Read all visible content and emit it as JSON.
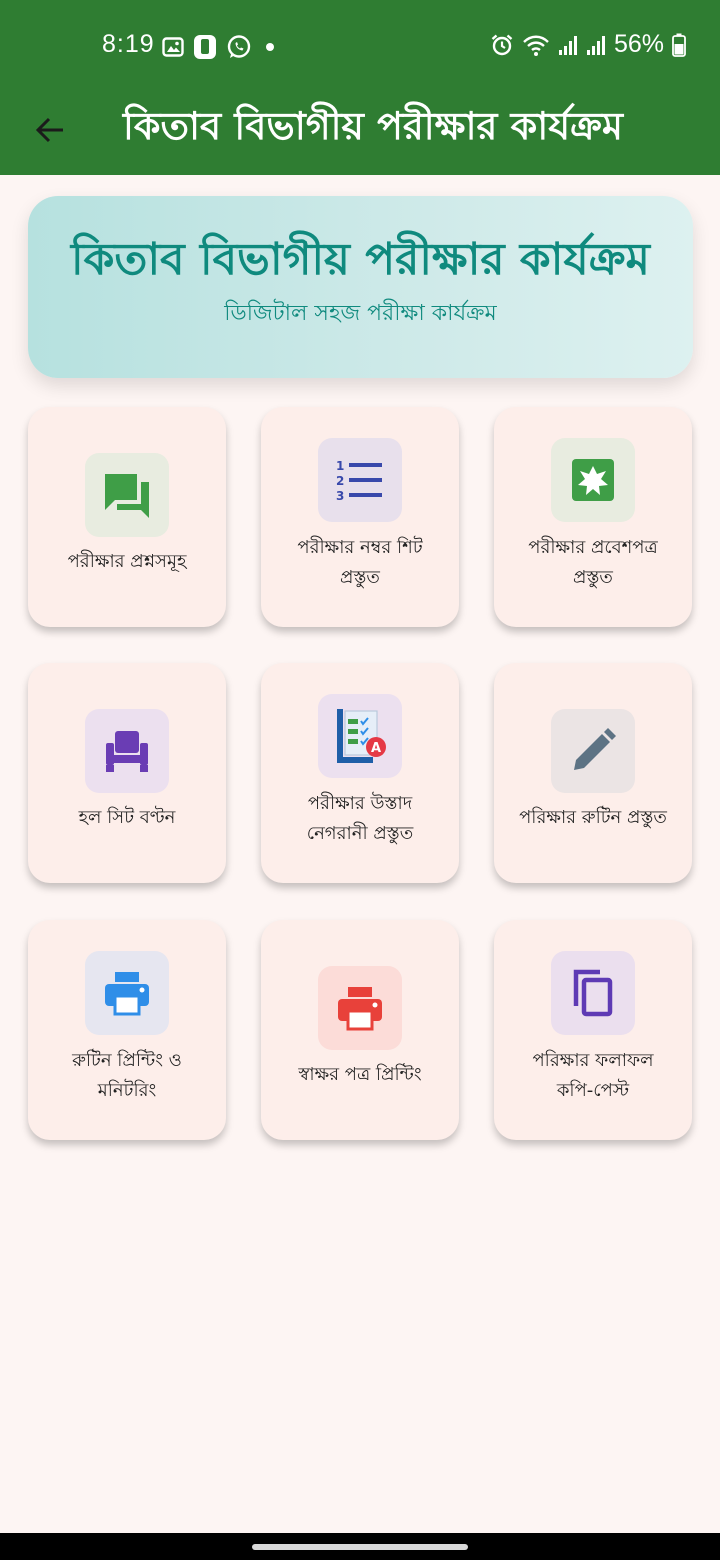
{
  "status": {
    "time": "8:19",
    "battery": "56%"
  },
  "app_bar": {
    "title": "কিতাব বিভাগীয় পরীক্ষার কার্যক্রম"
  },
  "hero": {
    "title": "কিতাব বিভাগীয় পরীক্ষার কার্যক্রম",
    "subtitle": "ডিজিটাল সহজ পরীক্ষা কার্যক্রম"
  },
  "cards": [
    {
      "label_1": "পরীক্ষার প্রশ্নসমূহ",
      "label_2": "",
      "icon": "chat-bubbles-icon",
      "icon_bg": "#e8ece0",
      "icon_color": "#3f9e47"
    },
    {
      "label_1": "পরীক্ষার নম্বর শিট",
      "label_2": "প্রস্তুত",
      "icon": "numbered-list-icon",
      "icon_bg": "#e8e0ec",
      "icon_color": "#3949ab"
    },
    {
      "label_1": "পরীক্ষার প্রবেশপত্র",
      "label_2": "প্রস্তুত",
      "icon": "admit-card-icon",
      "icon_bg": "#e8ece0",
      "icon_color": "#3f9e47"
    },
    {
      "label_1": "হল সিট বণ্টন",
      "label_2": "",
      "icon": "seat-icon",
      "icon_bg": "#ece0ef",
      "icon_color": "#6a3db4"
    },
    {
      "label_1": "পরীক্ষার উস্তাদ",
      "label_2": "নেগরানী প্রস্তুত",
      "icon": "checklist-grade-icon",
      "icon_bg": "#ece0ef",
      "icon_color": "#1e5ea8"
    },
    {
      "label_1": "পরিক্ষার রুটিন প্রস্তুত",
      "label_2": "",
      "icon": "pencil-icon",
      "icon_bg": "#ebe4e4",
      "icon_color": "#5d7384"
    },
    {
      "label_1": "রুটিন প্রিন্টিং ও",
      "label_2": "মনিটরিং",
      "icon": "printer-icon",
      "icon_bg": "#e6e6f0",
      "icon_color": "#2f8ee8"
    },
    {
      "label_1": "স্বাক্ষর পত্র প্রিন্টিং",
      "label_2": "",
      "icon": "printer-icon",
      "icon_bg": "#fcdcd8",
      "icon_color": "#e8413a"
    },
    {
      "label_1": "পরিক্ষার ফলাফল",
      "label_2": "কপি-পেস্ট",
      "icon": "copy-icon",
      "icon_bg": "#ebdfee",
      "icon_color": "#5e3ab4"
    }
  ],
  "colors": {
    "primary": "#2f7d32",
    "accent_teal": "#0f8a7e",
    "card_bg": "#fdeeea",
    "page_bg": "#fdf5f3"
  }
}
